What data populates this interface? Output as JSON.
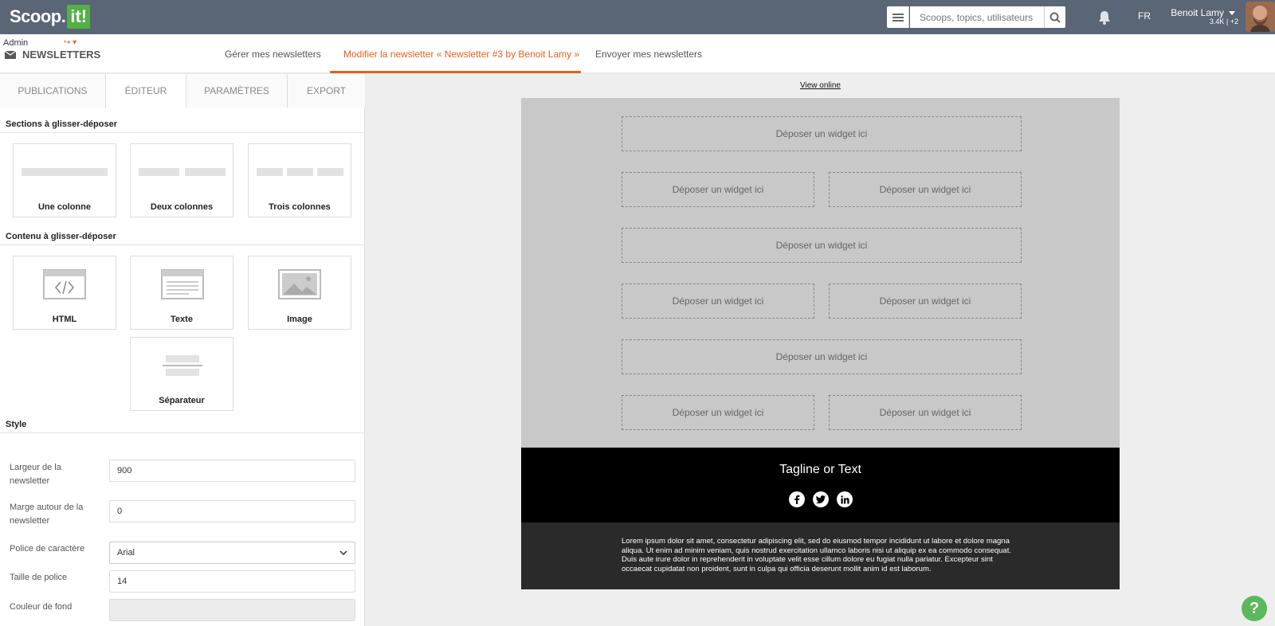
{
  "brand": {
    "logo_text": "Scoop.",
    "logo_box": "it!"
  },
  "topbar": {
    "search_placeholder": "Scoops, topics, utilisateurs",
    "lang": "FR",
    "user_name": "Benoit Lamy",
    "user_stats": "3.4K | +2"
  },
  "subheader": {
    "admin_label": "Admin",
    "section_title": "NEWSLETTERS",
    "nav": [
      "Gérer mes newsletters",
      "Modifier la newsletter « Newsletter #3 by Benoit Lamy »",
      "Envoyer mes newsletters"
    ]
  },
  "tabs": [
    "PUBLICATIONS",
    "ÉDITEUR",
    "PARAMÈTRES",
    "EXPORT"
  ],
  "sections": {
    "title": "Sections à glisser-déposer",
    "items": [
      "Une colonne",
      "Deux colonnes",
      "Trois colonnes"
    ]
  },
  "content": {
    "title": "Contenu à glisser-déposer",
    "items": [
      "HTML",
      "Texte",
      "Image",
      "Séparateur"
    ]
  },
  "style": {
    "title": "Style",
    "fields": [
      {
        "label": "Largeur de la newsletter",
        "value": "900"
      },
      {
        "label": "Marge autour de la newsletter",
        "value": "0"
      },
      {
        "label": "Police de caractère",
        "value": "Arial"
      },
      {
        "label": "Taille de police",
        "value": "14"
      },
      {
        "label": "Couleur de fond",
        "value": ""
      }
    ]
  },
  "preview": {
    "view_online": "View online",
    "drop_label": "Déposer un widget ici",
    "tagline": "Tagline or Text",
    "lorem": "Lorem ipsum dolor sit amet, consectetur adipiscing elit, sed do eiusmod tempor incididunt ut labore et dolore magna aliqua. Ut enim ad minim veniam, quis nostrud exercitation ullamco laboris nisi ut aliquip ex ea commodo consequat. Duis aute irure dolor in reprehenderit in voluptate velit esse cillum dolore eu fugiat nulla pariatur. Excepteur sint occaecat cupidatat non proident, sunt in culpa qui officia deserunt mollit anim id est laborum."
  },
  "help_label": "?",
  "colors": {
    "accent": "#e8601c",
    "topbar": "#5a6576",
    "brand_green": "#52b044"
  }
}
